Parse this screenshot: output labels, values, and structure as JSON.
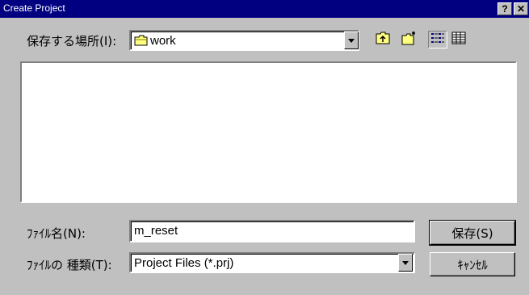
{
  "window": {
    "title": "Create Project",
    "help_button": "?",
    "close_button": "✕"
  },
  "look_in": {
    "label": "保存する場所(I):",
    "value": "work",
    "icon": "folder-icon"
  },
  "toolbar": {
    "buttons": [
      {
        "name": "up-one-level",
        "icon": "folder-up-icon"
      },
      {
        "name": "create-new-folder",
        "icon": "new-folder-icon"
      },
      {
        "name": "list-view",
        "icon": "list-view-icon"
      },
      {
        "name": "details-view",
        "icon": "details-view-icon"
      }
    ]
  },
  "file_list": [],
  "filename": {
    "label": "ﾌｧｲﾙ名(N):",
    "value": "m_reset"
  },
  "filetype": {
    "label": "ﾌｧｲﾙの 種類(T):",
    "value": "Project Files (*.prj)"
  },
  "buttons": {
    "save": "保存(S)",
    "cancel": "ｷｬﾝｾﾙ"
  },
  "colors": {
    "titlebar": "#000080",
    "face": "#c0c0c0"
  }
}
